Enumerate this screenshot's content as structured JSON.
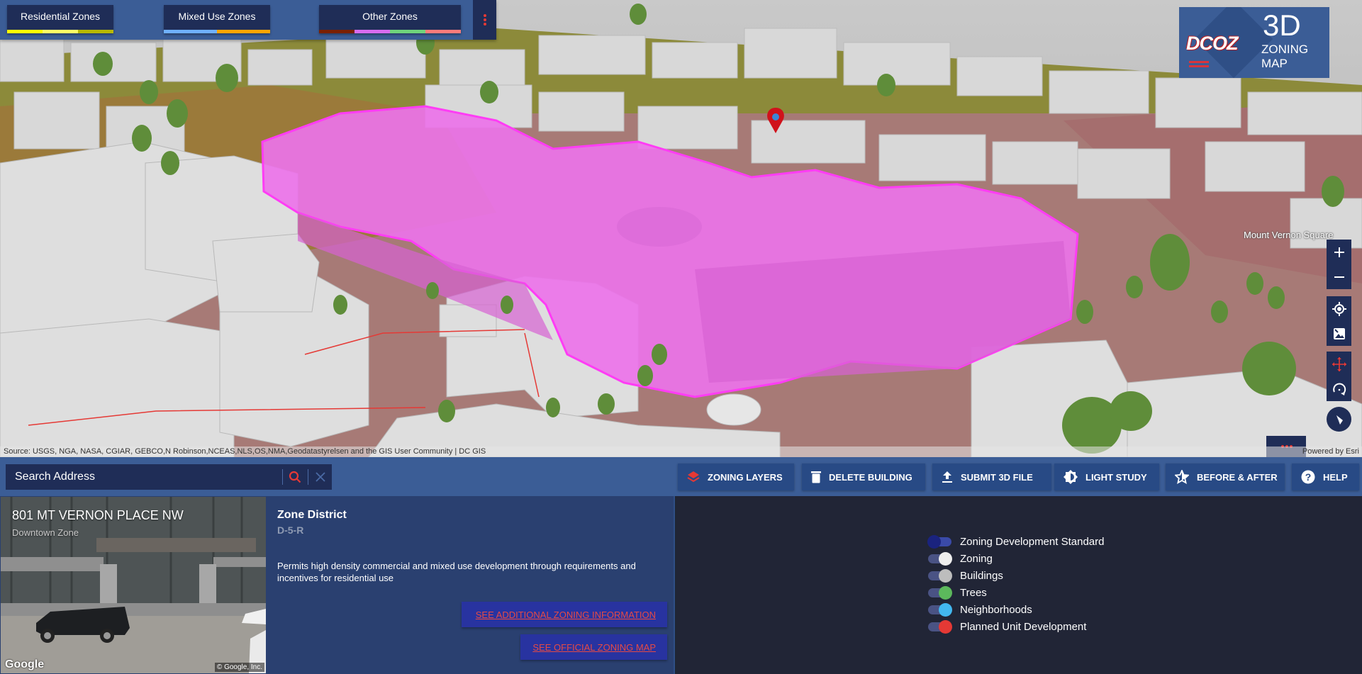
{
  "zone_tabs": [
    {
      "label": "Residential Zones",
      "swatches": [
        "#ffff00",
        "#ffff66",
        "#b8b800"
      ]
    },
    {
      "label": "Mixed Use Zones",
      "swatches": [
        "#6fb0ff",
        "#ffa500"
      ]
    },
    {
      "label": "Other Zones",
      "swatches": [
        "#7a2000",
        "#d86cf0",
        "#6fd47c",
        "#ff7b7b"
      ]
    }
  ],
  "logo": {
    "org": "DCOZ",
    "big": "3D",
    "line1": "ZONING",
    "line2": "MAP"
  },
  "map": {
    "place_label": "Mount Vernon Square",
    "attribution": "Source: USGS, NGA, NASA, CGIAR, GEBCO,N Robinson,NCEAS,NLS,OS,NMA,Geodatastyrelsen and the GIS User Community | DC GIS",
    "powered_by": "Powered by Esri",
    "controls": {
      "zoom_in": "zoom-in",
      "zoom_out": "zoom-out",
      "locate": "locate",
      "basemap": "basemap",
      "pan": "pan",
      "rotate": "rotate",
      "compass": "compass"
    },
    "highlight_color": "#e86de6",
    "marker_color": "#d0121b"
  },
  "toolbar": {
    "search_placeholder": "Search Address",
    "buttons": [
      {
        "label": "ZONING LAYERS",
        "icon": "layers-icon"
      },
      {
        "label": "DELETE BUILDING",
        "icon": "trash-icon"
      },
      {
        "label": "SUBMIT 3D FILE",
        "icon": "upload-icon"
      },
      {
        "label": "LIGHT STUDY",
        "icon": "brightness-icon"
      },
      {
        "label": "BEFORE & AFTER",
        "icon": "star-icon"
      },
      {
        "label": "HELP",
        "icon": "help-icon"
      }
    ]
  },
  "property": {
    "address": "801 MT VERNON PLACE NW",
    "zone_name": "Downtown Zone",
    "photo_brand": "Google",
    "photo_copyright": "© Google, Inc.",
    "zone_district_title": "Zone District",
    "zone_district_code": "D-5-R",
    "description": "Permits high density commercial and mixed use development through requirements and incentives for residential use",
    "link_additional": "SEE ADDITIONAL ZONING INFORMATION",
    "link_official": "SEE OFFICIAL ZONING MAP"
  },
  "layers": [
    {
      "label": "Zoning Development Standard",
      "on": false,
      "color": "#1a237e"
    },
    {
      "label": "Zoning",
      "on": true,
      "color": "#eeeeee"
    },
    {
      "label": "Buildings",
      "on": true,
      "color": "#bdbdbd"
    },
    {
      "label": "Trees",
      "on": true,
      "color": "#5cb85c"
    },
    {
      "label": "Neighborhoods",
      "on": true,
      "color": "#42b8f0"
    },
    {
      "label": "Planned Unit Development",
      "on": true,
      "color": "#e53935"
    }
  ]
}
